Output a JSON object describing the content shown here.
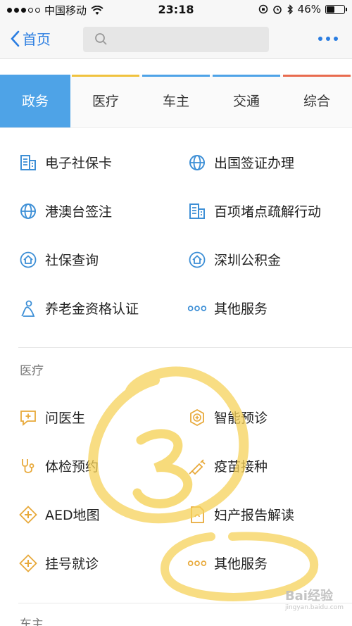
{
  "status_bar": {
    "carrier": "中国移动",
    "time": "23:18",
    "battery": "46%",
    "battery_level": 0.46
  },
  "nav": {
    "back_label": "首页",
    "search_placeholder": ""
  },
  "tabs": [
    {
      "label": "政务",
      "active": true,
      "color": "#4ea3e7"
    },
    {
      "label": "医疗",
      "color": "#f0c23e"
    },
    {
      "label": "车主",
      "color": "#4ea3e7"
    },
    {
      "label": "交通",
      "color": "#4ea3e7"
    },
    {
      "label": "综合",
      "color": "#e86b4f"
    }
  ],
  "gov": {
    "items": [
      {
        "label": "电子社保卡",
        "icon": "building-icon"
      },
      {
        "label": "出国签证办理",
        "icon": "globe-icon"
      },
      {
        "label": "港澳台签注",
        "icon": "globe-icon"
      },
      {
        "label": "百项堵点疏解行动",
        "icon": "building-icon"
      },
      {
        "label": "社保查询",
        "icon": "house-shield-icon"
      },
      {
        "label": "深圳公积金",
        "icon": "house-shield-icon"
      },
      {
        "label": "养老金资格认证",
        "icon": "elder-icon"
      },
      {
        "label": "其他服务",
        "icon": "more-dots-icon"
      }
    ]
  },
  "medical": {
    "title": "医疗",
    "items": [
      {
        "label": "问医生",
        "icon": "chat-plus-icon"
      },
      {
        "label": "智能预诊",
        "icon": "smart-diagnosis-icon"
      },
      {
        "label": "体检预约",
        "icon": "stethoscope-icon"
      },
      {
        "label": "疫苗接种",
        "icon": "syringe-icon"
      },
      {
        "label": "AED地图",
        "icon": "aed-cross-icon"
      },
      {
        "label": "妇产报告解读",
        "icon": "report-icon"
      },
      {
        "label": "挂号就诊",
        "icon": "cross-icon"
      },
      {
        "label": "其他服务",
        "icon": "more-dots-icon"
      }
    ]
  },
  "next_section": {
    "title": "车主"
  },
  "annotation": {
    "number": "3"
  },
  "watermark": {
    "text": "Bai经验",
    "sub": "jingyan.baidu.com"
  },
  "colors": {
    "accent": "#2a7de1",
    "gov_icon": "#3d8fd6",
    "med_icon": "#e8a93a",
    "highlight": "#f5d25a"
  }
}
